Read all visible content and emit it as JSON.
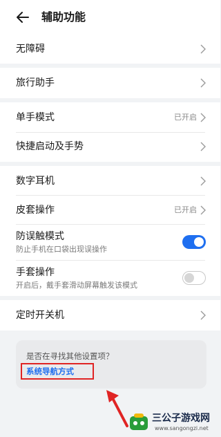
{
  "header": {
    "title": "辅助功能"
  },
  "groups": {
    "accessibility": {
      "label": "无障碍"
    },
    "travel": {
      "label": "旅行助手"
    },
    "one_hand": {
      "label": "单手模式",
      "value": "已开启"
    },
    "shortcut": {
      "label": "快捷启动及手势"
    },
    "earphone": {
      "label": "数字耳机"
    },
    "cover": {
      "label": "皮套操作",
      "value": "已开启"
    },
    "anti_mistouch": {
      "label": "防误触模式",
      "desc": "防止手机在口袋出现误操作",
      "enabled": true
    },
    "glove": {
      "label": "手套操作",
      "desc": "开启后，戴手套滑动屏幕触发该模式",
      "enabled": false
    },
    "timer_power": {
      "label": "定时开关机"
    }
  },
  "suggest": {
    "question": "是否在寻找其他设置项？",
    "link": "系统导航方式"
  },
  "watermark": {
    "title": "三公子游戏网",
    "url": "www.sangongzi.net"
  },
  "colors": {
    "accent": "#1f6ff0",
    "highlight_box": "#e02424",
    "background": "#f1f3f5"
  },
  "icons": [
    "back-arrow-icon",
    "chevron-right-icon",
    "toggle-switch",
    "annotation-arrow",
    "site-logo"
  ]
}
